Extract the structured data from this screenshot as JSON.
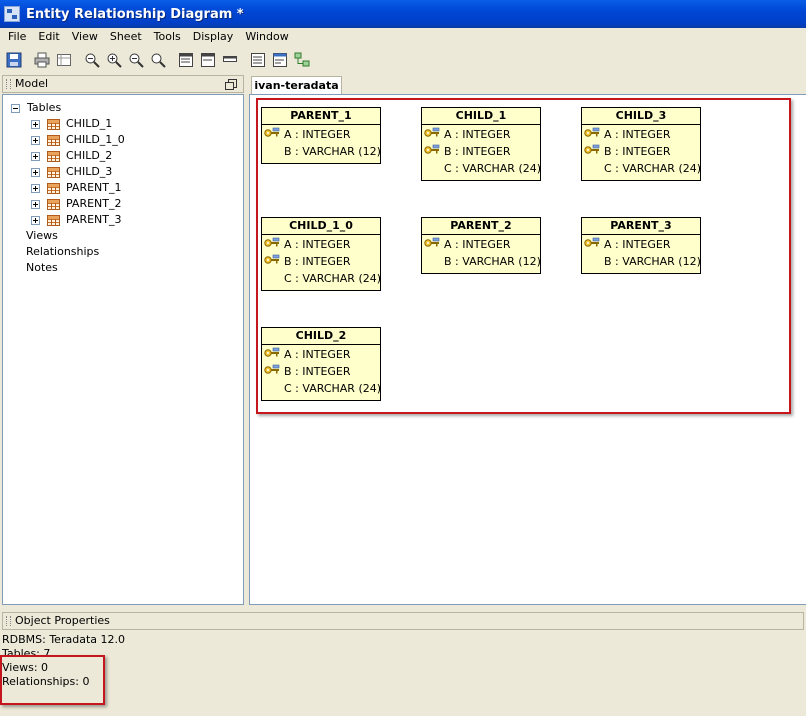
{
  "window": {
    "title": "Entity Relationship Diagram *"
  },
  "menu": [
    "File",
    "Edit",
    "View",
    "Sheet",
    "Tools",
    "Display",
    "Window"
  ],
  "toolbar": [
    {
      "icon": "save-icon"
    },
    {
      "sep": true
    },
    {
      "icon": "print-icon"
    },
    {
      "icon": "page-setup-icon"
    },
    {
      "sep": true
    },
    {
      "icon": "zoom-fit-icon"
    },
    {
      "icon": "zoom-in-icon"
    },
    {
      "icon": "zoom-out-icon"
    },
    {
      "icon": "zoom-icon"
    },
    {
      "sep": true
    },
    {
      "icon": "table-view-icon"
    },
    {
      "icon": "column-view-icon"
    },
    {
      "icon": "title-view-icon"
    },
    {
      "sep": true
    },
    {
      "icon": "layout-icon"
    },
    {
      "icon": "properties-icon"
    },
    {
      "icon": "arrange-icon"
    }
  ],
  "model_panel": {
    "title": "Model",
    "tables_label": "Tables",
    "tables": [
      "CHILD_1",
      "CHILD_1_0",
      "CHILD_2",
      "CHILD_3",
      "PARENT_1",
      "PARENT_2",
      "PARENT_3"
    ],
    "views_label": "Views",
    "relationships_label": "Relationships",
    "notes_label": "Notes"
  },
  "diagram": {
    "tab": "ivan-teradata",
    "entities": [
      {
        "name": "PARENT_1",
        "columns": [
          {
            "text": "A : INTEGER",
            "key": true
          },
          {
            "text": "B : VARCHAR (12)",
            "key": false
          }
        ]
      },
      {
        "name": "CHILD_1",
        "columns": [
          {
            "text": "A : INTEGER",
            "key": true
          },
          {
            "text": "B : INTEGER",
            "key": true
          },
          {
            "text": "C : VARCHAR (24)",
            "key": false
          }
        ]
      },
      {
        "name": "CHILD_3",
        "columns": [
          {
            "text": "A : INTEGER",
            "key": true
          },
          {
            "text": "B : INTEGER",
            "key": true
          },
          {
            "text": "C : VARCHAR (24)",
            "key": false
          }
        ]
      },
      {
        "name": "CHILD_1_0",
        "columns": [
          {
            "text": "A : INTEGER",
            "key": true
          },
          {
            "text": "B : INTEGER",
            "key": true
          },
          {
            "text": "C : VARCHAR (24)",
            "key": false
          }
        ]
      },
      {
        "name": "PARENT_2",
        "columns": [
          {
            "text": "A : INTEGER",
            "key": true
          },
          {
            "text": "B : VARCHAR (12)",
            "key": false
          }
        ]
      },
      {
        "name": "PARENT_3",
        "columns": [
          {
            "text": "A : INTEGER",
            "key": true
          },
          {
            "text": "B : VARCHAR (12)",
            "key": false
          }
        ]
      },
      {
        "name": "CHILD_2",
        "columns": [
          {
            "text": "A : INTEGER",
            "key": true
          },
          {
            "text": "B : INTEGER",
            "key": true
          },
          {
            "text": "C : VARCHAR (24)",
            "key": false
          }
        ]
      }
    ]
  },
  "properties": {
    "title": "Object Properties",
    "lines": [
      "RDBMS: Teradata 12.0",
      "Tables: 7",
      "Views: 0",
      "Relationships: 0"
    ]
  },
  "colors": {
    "highlight": "#c4161c",
    "entity_fill": "#ffffcc",
    "titlebar": "#0046d5"
  }
}
